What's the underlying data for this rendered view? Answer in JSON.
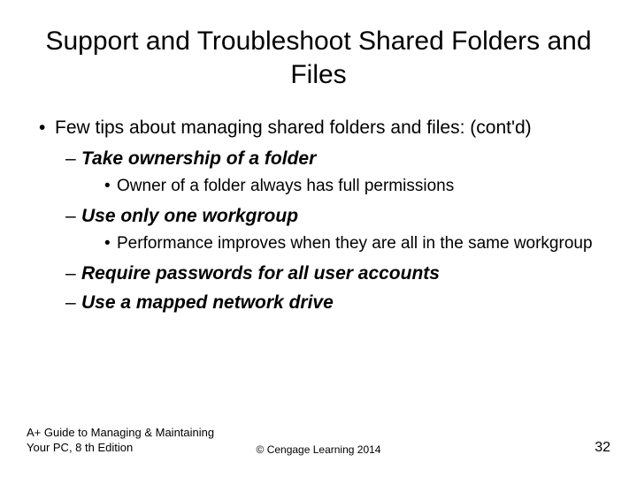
{
  "title": "Support and Troubleshoot Shared Folders and Files",
  "mainBullet": "Few tips about managing shared folders and files: (cont'd)",
  "items": [
    {
      "label": "Take ownership of a folder",
      "sub": "Owner of a folder always has full permissions"
    },
    {
      "label": "Use only one workgroup",
      "sub": "Performance improves when they are all in the same workgroup"
    },
    {
      "label": "Require passwords for all user accounts",
      "sub": null
    },
    {
      "label": "Use a mapped network drive",
      "sub": null
    }
  ],
  "footer": {
    "left": "A+ Guide to Managing & Maintaining Your PC, 8 th Edition",
    "center": "© Cengage Learning 2014",
    "right": "32"
  }
}
